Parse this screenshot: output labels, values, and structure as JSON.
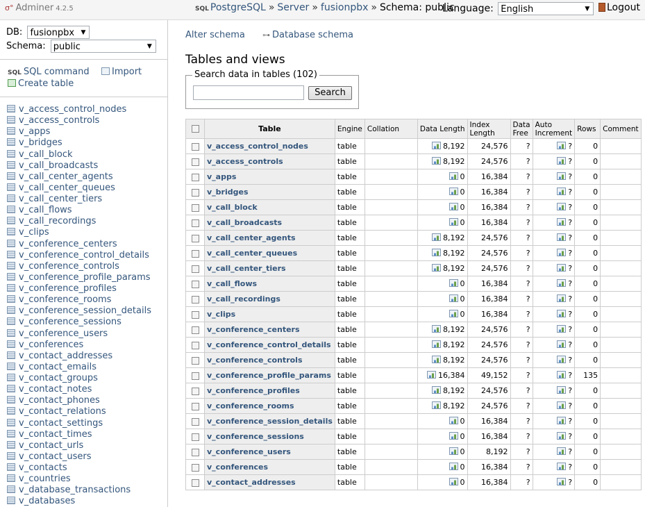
{
  "app": {
    "name": "Adminer",
    "version": "4.2.5"
  },
  "header": {
    "breadcrumb": {
      "driver_mark": "SQL",
      "driver": "PostgreSQL",
      "sep": "»",
      "server": "Server",
      "database": "fusionpbx",
      "schema_text": "Schema: public"
    },
    "language_label": "Language:",
    "language_value": "English",
    "logout": "Logout"
  },
  "sidebar": {
    "db_label": "DB:",
    "db_value": "fusionpbx",
    "schema_label": "Schema:",
    "schema_value": "public",
    "sql_mark": "SQL",
    "sql_command": "SQL command",
    "import": "Import",
    "create_table": "Create table",
    "tables": [
      "v_access_control_nodes",
      "v_access_controls",
      "v_apps",
      "v_bridges",
      "v_call_block",
      "v_call_broadcasts",
      "v_call_center_agents",
      "v_call_center_queues",
      "v_call_center_tiers",
      "v_call_flows",
      "v_call_recordings",
      "v_clips",
      "v_conference_centers",
      "v_conference_control_details",
      "v_conference_controls",
      "v_conference_profile_params",
      "v_conference_profiles",
      "v_conference_rooms",
      "v_conference_session_details",
      "v_conference_sessions",
      "v_conference_users",
      "v_conferences",
      "v_contact_addresses",
      "v_contact_emails",
      "v_contact_groups",
      "v_contact_notes",
      "v_contact_phones",
      "v_contact_relations",
      "v_contact_settings",
      "v_contact_times",
      "v_contact_urls",
      "v_contact_users",
      "v_contacts",
      "v_countries",
      "v_database_transactions",
      "v_databases"
    ]
  },
  "main": {
    "alter_schema": "Alter schema",
    "database_schema": "Database schema",
    "title": "Tables and views",
    "search_legend": "Search data in tables (102)",
    "search_value": "",
    "search_button": "Search",
    "columns": {
      "table": "Table",
      "engine": "Engine",
      "collation": "Collation",
      "data_length": "Data Length",
      "index_length_1": "Index",
      "index_length_2": "Length",
      "data_free_1": "Data",
      "data_free_2": "Free",
      "auto_increment_1": "Auto",
      "auto_increment_2": "Increment",
      "rows": "Rows",
      "comment": "Comment"
    },
    "rows": [
      {
        "name": "v_access_control_nodes",
        "engine": "table",
        "collation": "",
        "data_length": "8,192",
        "index_length": "24,576",
        "data_free": "?",
        "auto_increment": "?",
        "rows": "0",
        "comment": ""
      },
      {
        "name": "v_access_controls",
        "engine": "table",
        "collation": "",
        "data_length": "8,192",
        "index_length": "24,576",
        "data_free": "?",
        "auto_increment": "?",
        "rows": "0",
        "comment": ""
      },
      {
        "name": "v_apps",
        "engine": "table",
        "collation": "",
        "data_length": "0",
        "index_length": "16,384",
        "data_free": "?",
        "auto_increment": "?",
        "rows": "0",
        "comment": ""
      },
      {
        "name": "v_bridges",
        "engine": "table",
        "collation": "",
        "data_length": "0",
        "index_length": "16,384",
        "data_free": "?",
        "auto_increment": "?",
        "rows": "0",
        "comment": ""
      },
      {
        "name": "v_call_block",
        "engine": "table",
        "collation": "",
        "data_length": "0",
        "index_length": "16,384",
        "data_free": "?",
        "auto_increment": "?",
        "rows": "0",
        "comment": ""
      },
      {
        "name": "v_call_broadcasts",
        "engine": "table",
        "collation": "",
        "data_length": "0",
        "index_length": "16,384",
        "data_free": "?",
        "auto_increment": "?",
        "rows": "0",
        "comment": ""
      },
      {
        "name": "v_call_center_agents",
        "engine": "table",
        "collation": "",
        "data_length": "8,192",
        "index_length": "24,576",
        "data_free": "?",
        "auto_increment": "?",
        "rows": "0",
        "comment": ""
      },
      {
        "name": "v_call_center_queues",
        "engine": "table",
        "collation": "",
        "data_length": "8,192",
        "index_length": "24,576",
        "data_free": "?",
        "auto_increment": "?",
        "rows": "0",
        "comment": ""
      },
      {
        "name": "v_call_center_tiers",
        "engine": "table",
        "collation": "",
        "data_length": "8,192",
        "index_length": "24,576",
        "data_free": "?",
        "auto_increment": "?",
        "rows": "0",
        "comment": ""
      },
      {
        "name": "v_call_flows",
        "engine": "table",
        "collation": "",
        "data_length": "0",
        "index_length": "16,384",
        "data_free": "?",
        "auto_increment": "?",
        "rows": "0",
        "comment": ""
      },
      {
        "name": "v_call_recordings",
        "engine": "table",
        "collation": "",
        "data_length": "0",
        "index_length": "16,384",
        "data_free": "?",
        "auto_increment": "?",
        "rows": "0",
        "comment": ""
      },
      {
        "name": "v_clips",
        "engine": "table",
        "collation": "",
        "data_length": "0",
        "index_length": "16,384",
        "data_free": "?",
        "auto_increment": "?",
        "rows": "0",
        "comment": ""
      },
      {
        "name": "v_conference_centers",
        "engine": "table",
        "collation": "",
        "data_length": "8,192",
        "index_length": "24,576",
        "data_free": "?",
        "auto_increment": "?",
        "rows": "0",
        "comment": ""
      },
      {
        "name": "v_conference_control_details",
        "engine": "table",
        "collation": "",
        "data_length": "8,192",
        "index_length": "24,576",
        "data_free": "?",
        "auto_increment": "?",
        "rows": "0",
        "comment": ""
      },
      {
        "name": "v_conference_controls",
        "engine": "table",
        "collation": "",
        "data_length": "8,192",
        "index_length": "24,576",
        "data_free": "?",
        "auto_increment": "?",
        "rows": "0",
        "comment": ""
      },
      {
        "name": "v_conference_profile_params",
        "engine": "table",
        "collation": "",
        "data_length": "16,384",
        "index_length": "49,152",
        "data_free": "?",
        "auto_increment": "?",
        "rows": "135",
        "comment": ""
      },
      {
        "name": "v_conference_profiles",
        "engine": "table",
        "collation": "",
        "data_length": "8,192",
        "index_length": "24,576",
        "data_free": "?",
        "auto_increment": "?",
        "rows": "0",
        "comment": ""
      },
      {
        "name": "v_conference_rooms",
        "engine": "table",
        "collation": "",
        "data_length": "8,192",
        "index_length": "24,576",
        "data_free": "?",
        "auto_increment": "?",
        "rows": "0",
        "comment": ""
      },
      {
        "name": "v_conference_session_details",
        "engine": "table",
        "collation": "",
        "data_length": "0",
        "index_length": "16,384",
        "data_free": "?",
        "auto_increment": "?",
        "rows": "0",
        "comment": ""
      },
      {
        "name": "v_conference_sessions",
        "engine": "table",
        "collation": "",
        "data_length": "0",
        "index_length": "16,384",
        "data_free": "?",
        "auto_increment": "?",
        "rows": "0",
        "comment": ""
      },
      {
        "name": "v_conference_users",
        "engine": "table",
        "collation": "",
        "data_length": "0",
        "index_length": "8,192",
        "data_free": "?",
        "auto_increment": "?",
        "rows": "0",
        "comment": ""
      },
      {
        "name": "v_conferences",
        "engine": "table",
        "collation": "",
        "data_length": "0",
        "index_length": "16,384",
        "data_free": "?",
        "auto_increment": "?",
        "rows": "0",
        "comment": ""
      },
      {
        "name": "v_contact_addresses",
        "engine": "table",
        "collation": "",
        "data_length": "0",
        "index_length": "16,384",
        "data_free": "?",
        "auto_increment": "?",
        "rows": "0",
        "comment": ""
      }
    ]
  },
  "colors": {
    "link": "#34567c",
    "header_bg": "#f5f5f5",
    "table_head_bg": "#eeeeee",
    "border": "#cccccc"
  },
  "icons": {
    "logo": "adminer-logo-icon",
    "sql": "sql-icon",
    "import": "import-icon",
    "create": "create-table-icon",
    "schema": "schema-diagram-icon",
    "logout": "logout-door-icon",
    "table": "table-icon",
    "data_length": "bar-chart-icon"
  }
}
